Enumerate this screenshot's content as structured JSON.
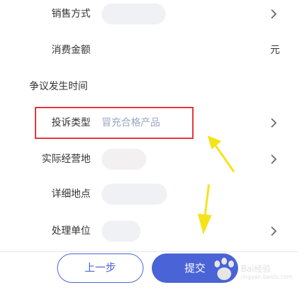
{
  "form": {
    "rows": [
      {
        "label": "销售方式"
      },
      {
        "label": "消费金额",
        "unit": "元"
      },
      {
        "label": "争议发生时间"
      },
      {
        "label": "投诉类型",
        "value": "冒充合格产品"
      },
      {
        "label": "实际经营地"
      },
      {
        "label": "详细地点"
      },
      {
        "label": "处理单位"
      }
    ]
  },
  "footer": {
    "prev_label": "上一步",
    "submit_label": "提交"
  },
  "watermark": {
    "text": "Bai经验",
    "sub": "jingyan.baidu.com"
  },
  "colors": {
    "accent": "#4a63d6",
    "highlight_border": "#e5353b",
    "annotation_arrow": "#f5e31a",
    "placeholder_value": "#9aa6c4"
  },
  "icons": [
    "chevron-right-icon",
    "yellow-arrow-annotation"
  ]
}
